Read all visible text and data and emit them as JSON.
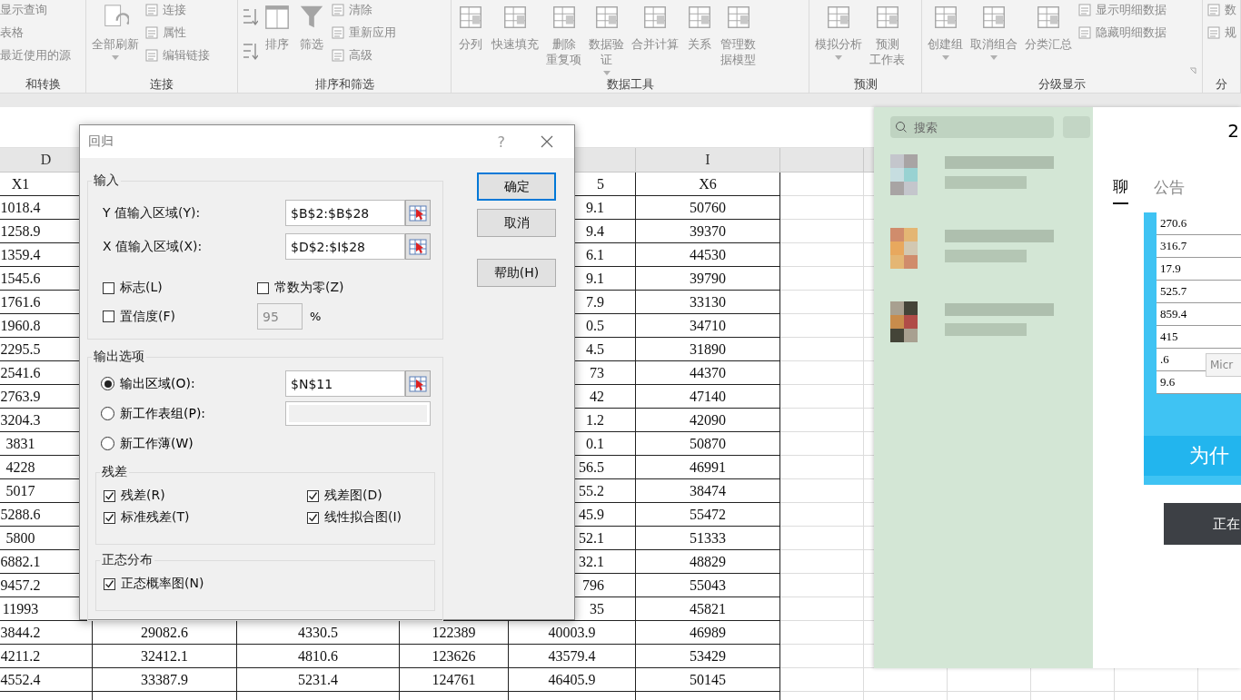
{
  "ribbon": {
    "groups": [
      {
        "label": "和转换",
        "columns": [
          {
            "kind": "stack",
            "items": [
              {
                "label": "显示查询"
              },
              {
                "label": "表格"
              },
              {
                "label": "最近使用的源"
              }
            ]
          }
        ]
      },
      {
        "label": "连接",
        "columns": [
          {
            "kind": "large",
            "label": "全部刷新",
            "menu": true
          },
          {
            "kind": "stack",
            "items": [
              {
                "label": "连接"
              },
              {
                "label": "属性"
              },
              {
                "label": "编辑链接"
              }
            ]
          }
        ]
      },
      {
        "label": "排序和筛选",
        "columns": [
          {
            "kind": "sort"
          },
          {
            "kind": "large",
            "label": "排序",
            "menu": false
          },
          {
            "kind": "large",
            "label": "筛选",
            "menu": false
          },
          {
            "kind": "stack",
            "items": [
              {
                "label": "清除"
              },
              {
                "label": "重新应用"
              },
              {
                "label": "高级"
              }
            ]
          }
        ]
      },
      {
        "label": "数据工具",
        "columns": [
          {
            "kind": "large",
            "label": "分列",
            "menu": false
          },
          {
            "kind": "large",
            "label": "快速填充",
            "menu": false
          },
          {
            "kind": "large",
            "lines": [
              "删除",
              "重复项"
            ],
            "menu": false
          },
          {
            "kind": "large",
            "lines": [
              "数据验",
              "证"
            ],
            "menu": true
          },
          {
            "kind": "large",
            "label": "合并计算",
            "menu": false
          },
          {
            "kind": "large",
            "label": "关系",
            "menu": false
          },
          {
            "kind": "large",
            "lines": [
              "管理数",
              "据模型"
            ],
            "menu": false
          }
        ]
      },
      {
        "label": "预测",
        "columns": [
          {
            "kind": "large",
            "label": "模拟分析",
            "menu": true
          },
          {
            "kind": "large",
            "lines": [
              "预测",
              "工作表"
            ],
            "menu": false
          }
        ]
      },
      {
        "label": "分级显示",
        "columns": [
          {
            "kind": "large",
            "label": "创建组",
            "menu": true
          },
          {
            "kind": "large",
            "label": "取消组合",
            "menu": true
          },
          {
            "kind": "large",
            "label": "分类汇总",
            "menu": false
          },
          {
            "kind": "stack",
            "items": [
              {
                "label": "显示明细数据"
              },
              {
                "label": "隐藏明细数据"
              }
            ]
          }
        ]
      },
      {
        "label": "分",
        "columns": [
          {
            "kind": "stack",
            "items": [
              {
                "label": "数"
              },
              {
                "label": "规"
              }
            ]
          }
        ]
      }
    ]
  },
  "sheet": {
    "column_headers": {
      "D": "D",
      "I": "I"
    },
    "rows": [
      {
        "D": "X1",
        "H": "5",
        "I": "X6"
      },
      {
        "D": "1018.4",
        "H": "9.1",
        "I": "50760"
      },
      {
        "D": "1258.9",
        "H": "9.4",
        "I": "39370"
      },
      {
        "D": "1359.4",
        "H": "6.1",
        "I": "44530"
      },
      {
        "D": "1545.6",
        "H": "9.1",
        "I": "39790"
      },
      {
        "D": "1761.6",
        "H": "7.9",
        "I": "33130"
      },
      {
        "D": "1960.8",
        "H": "0.5",
        "I": "34710"
      },
      {
        "D": "2295.5",
        "H": "4.5",
        "I": "31890"
      },
      {
        "D": "2541.6",
        "H": "73",
        "I": "44370"
      },
      {
        "D": "2763.9",
        "H": "42",
        "I": "47140"
      },
      {
        "D": "3204.3",
        "H": "1.2",
        "I": "42090"
      },
      {
        "D": "3831",
        "H": "0.1",
        "I": "50870"
      },
      {
        "D": "4228",
        "H": "56.5",
        "I": "46991"
      },
      {
        "D": "5017",
        "H": "55.2",
        "I": "38474"
      },
      {
        "D": "5288.6",
        "H": "45.9",
        "I": "55472"
      },
      {
        "D": "5800",
        "H": "52.1",
        "I": "51333"
      },
      {
        "D": "6882.1",
        "H": "32.1",
        "I": "48829"
      },
      {
        "D": "9457.2",
        "H": "796",
        "I": "55043"
      },
      {
        "D": "11993",
        "H": "35",
        "I": "45821"
      },
      {
        "D": "3844.2",
        "E": "29082.6",
        "F": "4330.5",
        "G": "122389",
        "H": "40003.9",
        "I": "46989"
      },
      {
        "D": "4211.2",
        "E": "32412.1",
        "F": "4810.6",
        "G": "123626",
        "H": "43579.4",
        "I": "53429"
      },
      {
        "D": "4552.4",
        "E": "33387.9",
        "F": "5231.4",
        "G": "124761",
        "H": "46405.9",
        "I": "50145"
      }
    ]
  },
  "dialog": {
    "title": "回归",
    "help": "?",
    "input": {
      "label": "输入",
      "fields": [
        {
          "label": "Y 值输入区域(Y):",
          "value": "$B$2:$B$28"
        },
        {
          "label": "X 值输入区域(X):",
          "value": "$D$2:$I$28"
        }
      ],
      "checkboxes": [
        {
          "label": "标志(L)",
          "checked": false
        },
        {
          "label": "常数为零(Z)",
          "checked": false
        },
        {
          "label": "置信度(F)",
          "checked": false
        }
      ],
      "confidence": {
        "value": "95",
        "disabled": true
      },
      "percent": "%"
    },
    "output": {
      "label": "输出选项",
      "options": [
        {
          "kind": "range",
          "label": "输出区域(O):",
          "selected": true,
          "value": "$N$11"
        },
        {
          "kind": "text",
          "label": "新工作表组(P):",
          "selected": false
        },
        {
          "kind": "plain",
          "label": "新工作薄(W)",
          "selected": false
        }
      ],
      "residuals": {
        "label": "残差",
        "checkboxes": [
          {
            "label": "残差(R)",
            "checked": true
          },
          {
            "label": "残差图(D)",
            "checked": true
          },
          {
            "label": "标准残差(T)",
            "checked": true
          },
          {
            "label": "线性拟合图(I)",
            "checked": true
          }
        ]
      },
      "normal": {
        "label": "正态分布",
        "checkboxes": [
          {
            "label": "正态概率图(N)",
            "checked": true
          }
        ]
      }
    },
    "buttons": [
      {
        "label": "确定",
        "default": true
      },
      {
        "label": "取消",
        "default": false
      },
      {
        "label": "帮助(H)",
        "default": false
      }
    ]
  },
  "chat_panel": {
    "search_placeholder": "搜索",
    "corner": "2",
    "tabs": [
      {
        "label": "聊",
        "selected": true
      },
      {
        "label": "公告",
        "selected": false
      }
    ],
    "cells": [
      "270.6",
      "316.7",
      "17.9",
      "525.7",
      "859.4",
      "415",
      ".6",
      "9.6"
    ],
    "popup": "Micr",
    "banner": "为什",
    "toast": "正在"
  }
}
